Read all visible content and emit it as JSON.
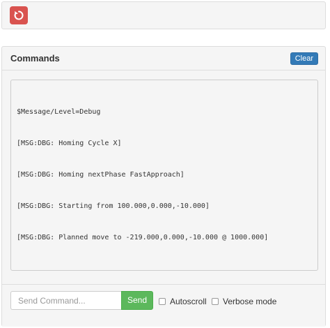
{
  "toolbar": {
    "reset_icon": "restart-icon",
    "reset_color": "#d9534f"
  },
  "commands": {
    "title": "Commands",
    "clear_label": "Clear",
    "log": [
      "$Message/Level=Debug",
      "[MSG:DBG: Homing Cycle X]",
      "[MSG:DBG: Homing nextPhase FastApproach]",
      "[MSG:DBG: Starting from 100.000,0.000,-10.000]",
      "[MSG:DBG: Planned move to -219.000,0.000,-10.000 @ 1000.000]"
    ]
  },
  "footer": {
    "input_placeholder": "Send Command...",
    "input_value": "",
    "send_label": "Send",
    "autoscroll_label": "Autoscroll",
    "autoscroll_checked": false,
    "verbose_label": "Verbose mode",
    "verbose_checked": false
  },
  "colors": {
    "primary": "#337ab7",
    "success": "#5cb85c",
    "danger": "#d9534f"
  }
}
